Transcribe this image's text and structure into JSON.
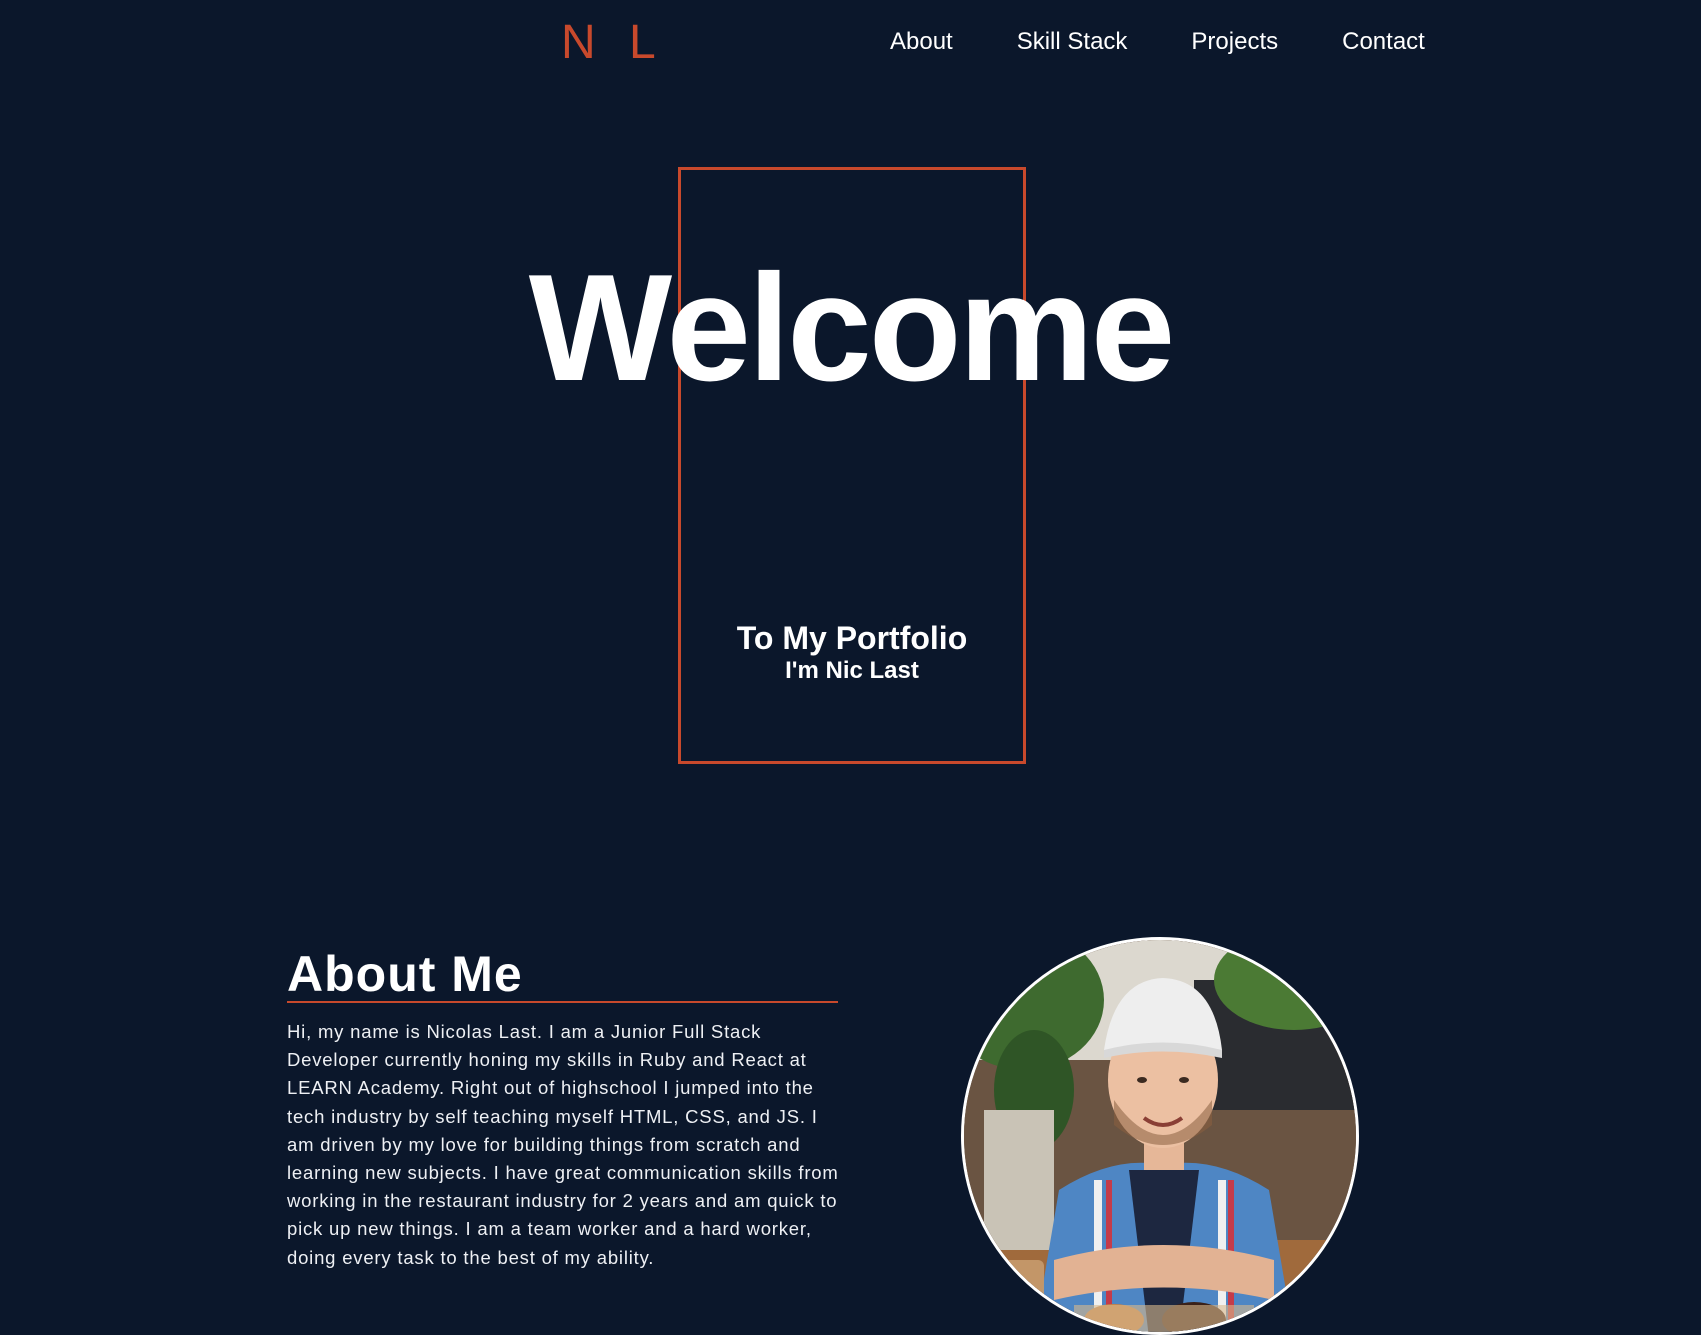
{
  "header": {
    "logo": "N L",
    "nav": [
      {
        "label": "About"
      },
      {
        "label": "Skill Stack"
      },
      {
        "label": "Projects"
      },
      {
        "label": "Contact"
      }
    ]
  },
  "hero": {
    "title": "Welcome",
    "subtitle": "To My Portfolio",
    "name": "I'm Nic Last"
  },
  "about": {
    "heading": "About Me",
    "body": "Hi, my name is Nicolas Last. I am a Junior Full Stack Developer currently honing my skills in Ruby and React at LEARN Academy. Right out of highschool I jumped into the tech industry by self teaching myself HTML, CSS, and JS. I am driven by my love for building things from scratch and learning new subjects. I have great communication skills from working in the restaurant industry for 2 years and am quick to pick up new things. I am a team worker and a hard worker, doing every task to the best of my ability."
  },
  "colors": {
    "background": "#0b172b",
    "accent": "#c8492c",
    "text": "#ffffff"
  }
}
